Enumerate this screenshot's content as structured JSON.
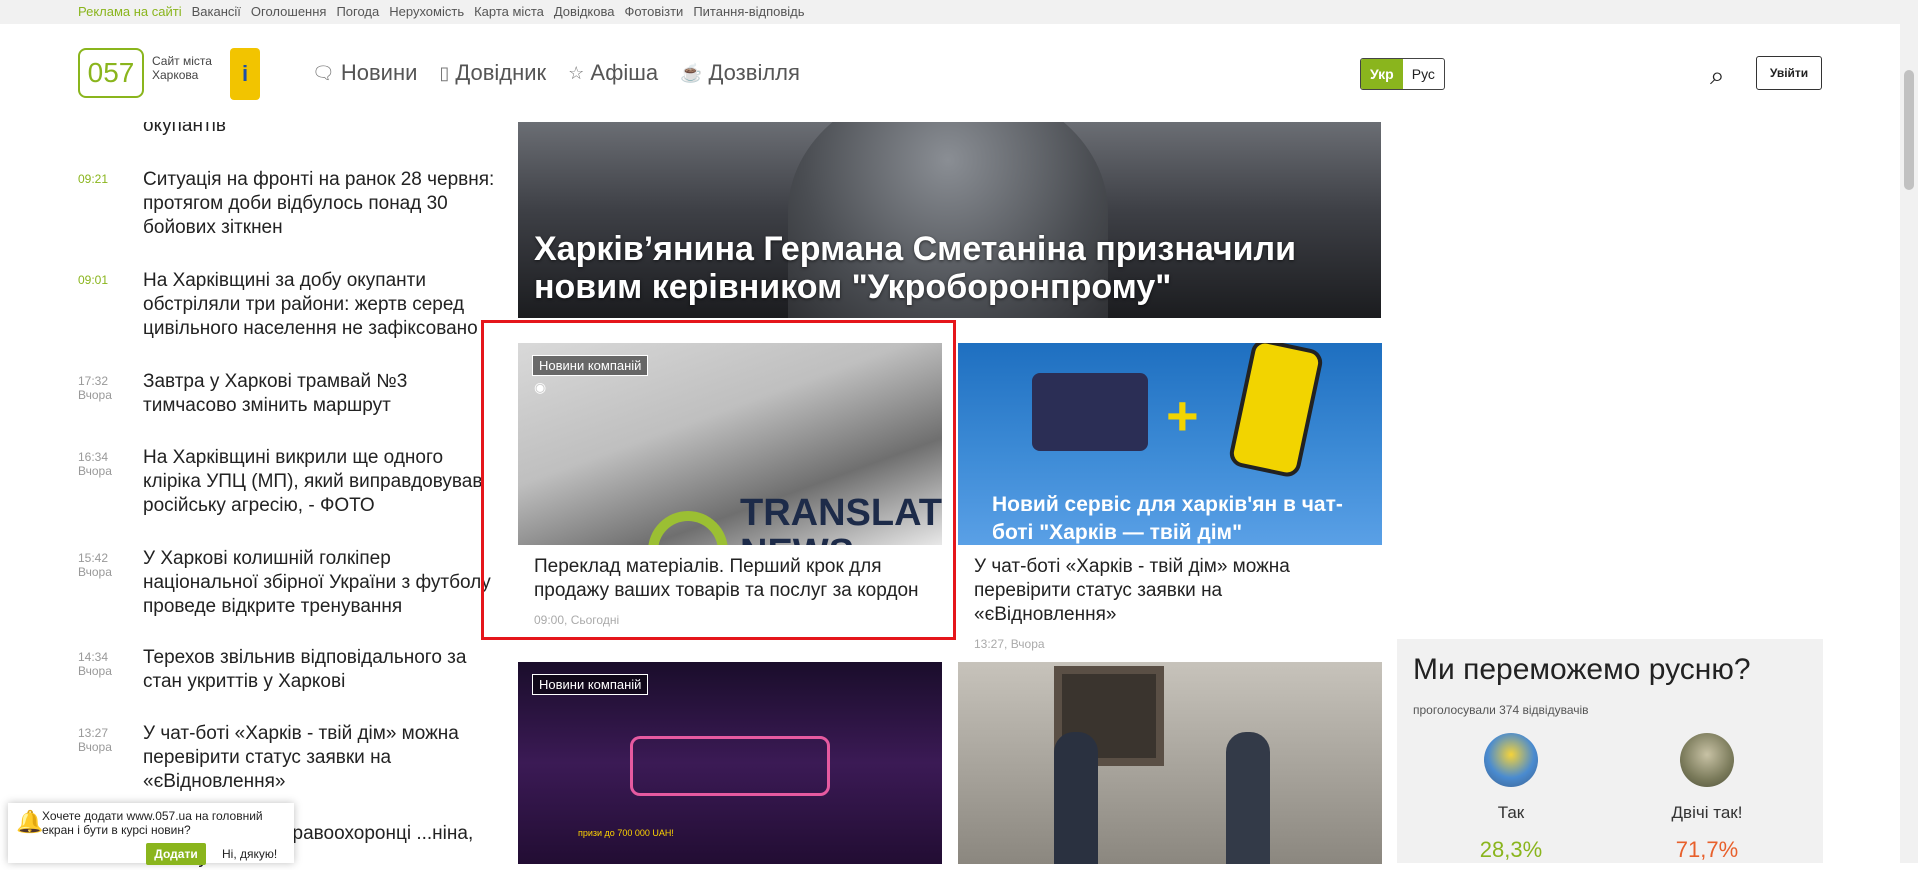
{
  "topbar": {
    "links": [
      "Реклама на сайті",
      "Вакансії",
      "Оголошення",
      "Погода",
      "Нерухомість",
      "Карта міста",
      "Довідкова",
      "Фотовізти",
      "Питання-відповідь"
    ]
  },
  "header": {
    "logo_number": "057",
    "logo_text_line1": "Сайт міста",
    "logo_text_line2": "Харкова",
    "badge_letter": "i",
    "nav": [
      {
        "label": "Новини",
        "icon": "chat-bubble-icon"
      },
      {
        "label": "Довідник",
        "icon": "book-icon"
      },
      {
        "label": "Афіша",
        "icon": "star-icon"
      },
      {
        "label": "Дозвілля",
        "icon": "coffee-icon"
      }
    ],
    "lang_ukr": "Укр",
    "lang_rus": "Рус",
    "login_label": "Увійти"
  },
  "newslist": {
    "items": [
      {
        "time": "",
        "date": "",
        "title": "окупантів"
      },
      {
        "time": "09:21",
        "date": "",
        "title": "Ситуація на фронті на ранок 28 червня: протягом доби відбулось понад 30 бойових зіткнен"
      },
      {
        "time": "09:01",
        "date": "",
        "title": "На Харківщині за добу окупанти обстріляли три райони: жертв серед цивільного населення не зафіксовано"
      },
      {
        "time": "17:32",
        "date": "Вчора",
        "title": "Завтра у Харкові трамвай №3 тимчасово змінить маршрут"
      },
      {
        "time": "16:34",
        "date": "Вчора",
        "title": "На Харківщині викрили ще одного кліріка УПЦ (МП), який виправдовував російську агресію, - ФОТО"
      },
      {
        "time": "15:42",
        "date": "Вчора",
        "title": "У Харкові колишній голкіпер національної збірної України з футболу проведе відкрите тренування"
      },
      {
        "time": "14:34",
        "date": "Вчора",
        "title": "Терехов звільнив відповідального за стан укриттів у Харкові"
      },
      {
        "time": "13:27",
        "date": "Вчора",
        "title": "У чат-боті «Харків - твій дім» можна перевірити статус заявки на «єВідновлення»"
      },
      {
        "time": "",
        "date": "",
        "title": "«Слава росії» - правоохоронці ...ніна, який публічно"
      }
    ]
  },
  "hero": {
    "title": "Харків’янина Германа Сметаніна призначили новим керівником \"Укроборонпрому\""
  },
  "cards": [
    {
      "badge": "Новини компаній",
      "title": "Переклад матеріалів. Перший крок для продажу ваших товарів та послуг за кордон",
      "meta": "09:00, Сьогодні",
      "image_text": "TRANSLATION NEWS"
    },
    {
      "badge": "",
      "title": "У чат-боті «Харків - твій дім» можна перевірити статус заявки на «єВідновлення»",
      "meta": "13:27, Вчора",
      "image_text": "Новий сервіс для харків'ян в чат-боті \"Харків — твій дім\""
    },
    {
      "badge": "Новини компаній",
      "title": "",
      "meta": "",
      "image_text": "призи до 700 000 UAH!"
    },
    {
      "badge": "",
      "title": "",
      "meta": "",
      "image_text": ""
    }
  ],
  "poll": {
    "title": "Ми переможемо русню?",
    "subtitle": "проголосували 374 відвідувачів",
    "options": [
      {
        "label": "Так",
        "percent": "28,3%"
      },
      {
        "label": "Двічі так!",
        "percent": "71,7%"
      }
    ]
  },
  "push": {
    "text": "Хочете додати www.057.ua на головний екран і бути в курсі новин?",
    "add_label": "Додати",
    "no_label": "Ні, дякую!"
  },
  "colors": {
    "accent": "#8ab51d",
    "highlight": "#e5161b",
    "poll_orange": "#e8602c"
  }
}
